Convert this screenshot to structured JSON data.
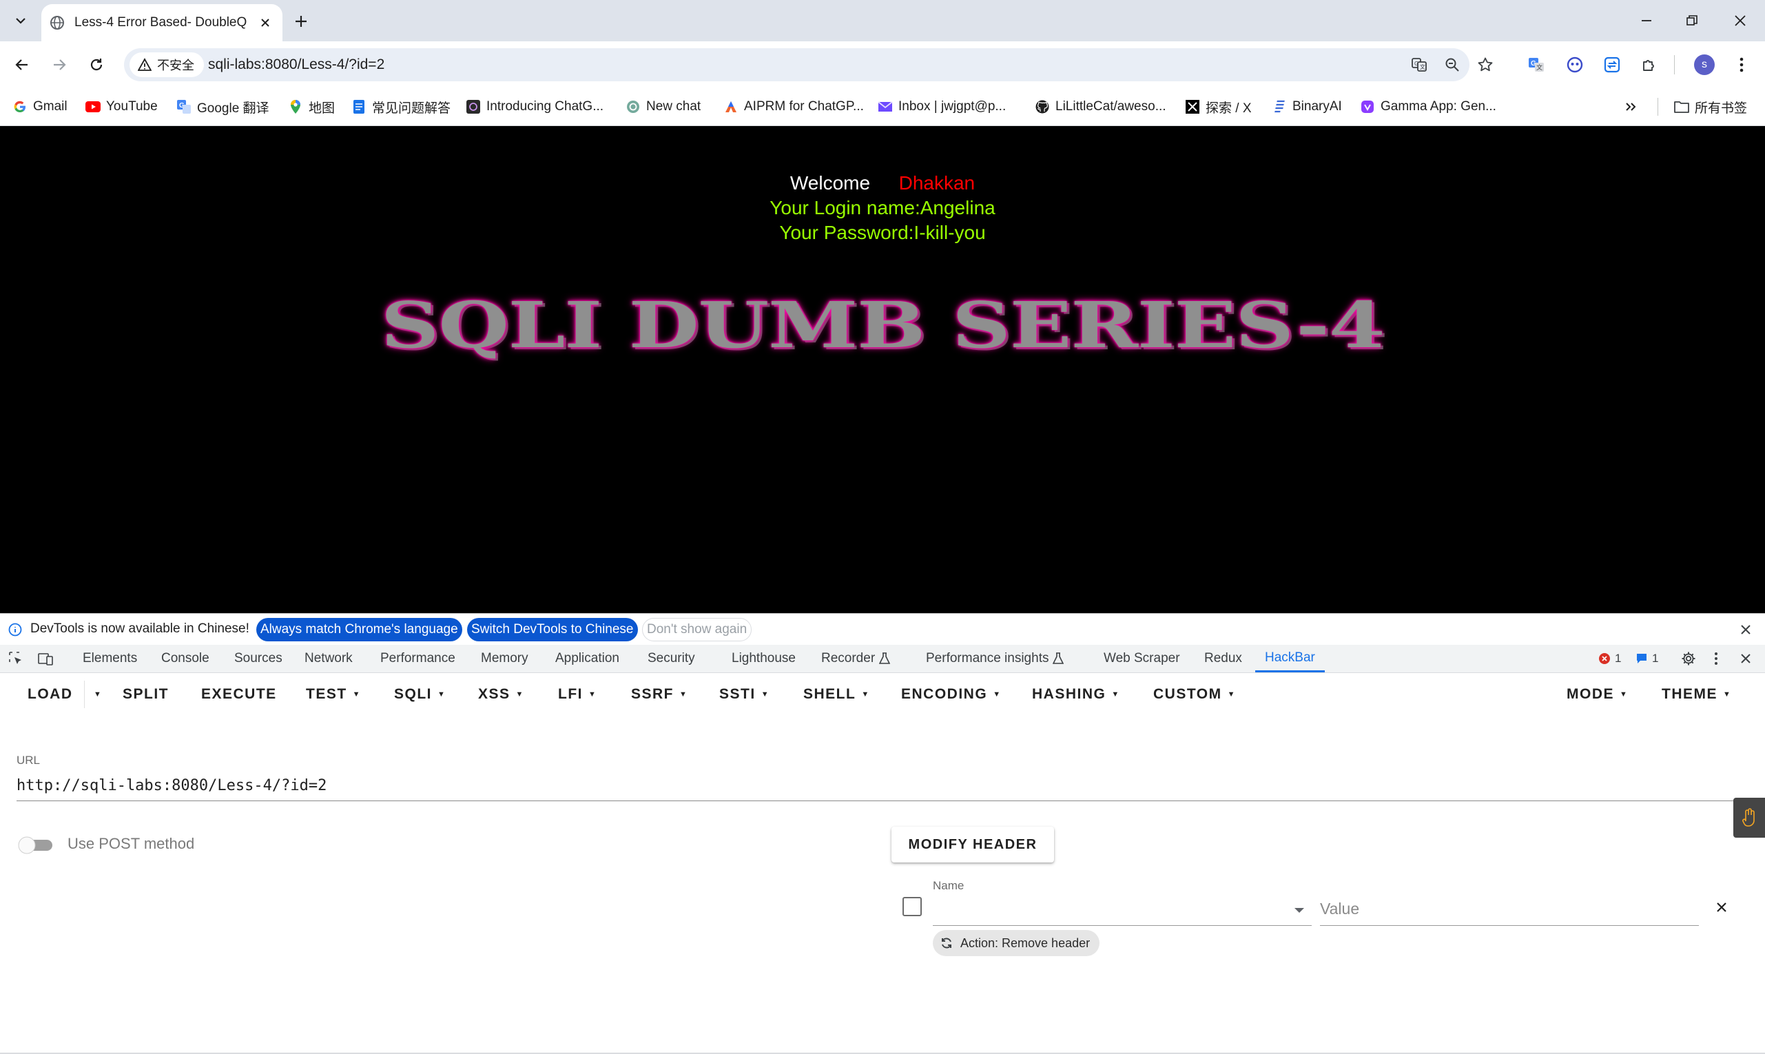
{
  "browser": {
    "tab_title": "Less-4 Error Based- DoubleQ",
    "security_label": "不安全",
    "url": "sqli-labs:8080/Less-4/?id=2",
    "profile_initial": "s"
  },
  "bookmarks": [
    {
      "label": "Gmail",
      "icon": "gmail-icon"
    },
    {
      "label": "YouTube",
      "icon": "youtube-icon"
    },
    {
      "label": "Google 翻译",
      "icon": "google-translate-icon"
    },
    {
      "label": "地图",
      "icon": "maps-pin-icon"
    },
    {
      "label": "常见问题解答",
      "icon": "doc-icon"
    },
    {
      "label": "Introducing ChatG...",
      "icon": "openai-icon"
    },
    {
      "label": "New chat",
      "icon": "chatgpt-icon"
    },
    {
      "label": "AIPRM for ChatGP...",
      "icon": "aiprm-icon"
    },
    {
      "label": "Inbox | jwjgpt@p...",
      "icon": "mail-icon"
    },
    {
      "label": "LiLittleCat/aweso...",
      "icon": "github-icon"
    },
    {
      "label": "探索 / X",
      "icon": "x-icon"
    },
    {
      "label": "BinaryAI",
      "icon": "binaryai-icon"
    },
    {
      "label": "Gamma App: Gen...",
      "icon": "gamma-icon"
    }
  ],
  "bookmarks_all_label": "所有书签",
  "page": {
    "welcome": "Welcome",
    "user": "Dhakkan",
    "login_line": "Your Login name:Angelina",
    "password_line": "Your Password:I-kill-you",
    "title": "SQLI DUMB SERIES-4",
    "colors": {
      "background": "#000000",
      "user": "#ff0000",
      "info": "#99ff00"
    }
  },
  "devtools": {
    "infobar_text": "DevTools is now available in Chinese!",
    "match_language": "Always match Chrome's language",
    "switch_chinese": "Switch DevTools to Chinese",
    "dont_show": "Don't show again",
    "tabs": [
      "Elements",
      "Console",
      "Sources",
      "Network",
      "Performance",
      "Memory",
      "Application",
      "Security",
      "Lighthouse",
      "Recorder",
      "Performance insights",
      "Web Scraper",
      "Redux",
      "HackBar"
    ],
    "active_tab": "HackBar",
    "error_count": "1",
    "message_count": "1"
  },
  "hackbar": {
    "menu": {
      "load": "LOAD",
      "split": "SPLIT",
      "execute": "EXECUTE",
      "test": "TEST",
      "sqli": "SQLI",
      "xss": "XSS",
      "lfi": "LFI",
      "ssrf": "SSRF",
      "ssti": "SSTI",
      "shell": "SHELL",
      "encoding": "ENCODING",
      "hashing": "HASHING",
      "custom": "CUSTOM",
      "mode": "MODE",
      "theme": "THEME"
    },
    "url_label": "URL",
    "url_value": "http://sqli-labs:8080/Less-4/?id=2",
    "post_label": "Use POST method",
    "post_enabled": false,
    "modify_header": "MODIFY HEADER",
    "header_name_label": "Name",
    "header_value_placeholder": "Value",
    "header_action": "Action: Remove header"
  }
}
